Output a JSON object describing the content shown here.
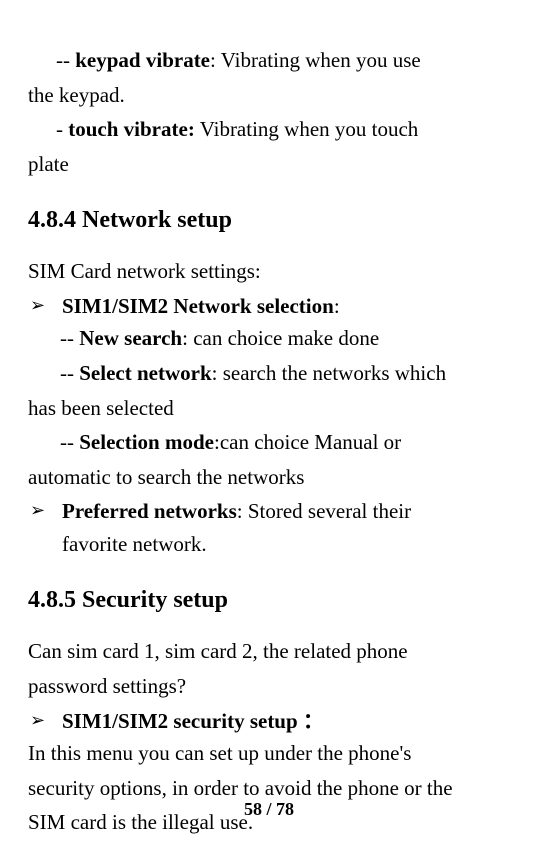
{
  "intro": {
    "line1_prefix": "--  ",
    "line1_bold": "keypad vibrate",
    "line1_colon": ":",
    "line1_rest": "  Vibrating when you use",
    "line2": "the keypad.",
    "line3_prefix": "-  ",
    "line3_bold": "touch vibrate:",
    "line3_rest": " Vibrating when you touch",
    "line4": "plate"
  },
  "section484": {
    "heading": "4.8.4 Network setup",
    "lead": "SIM Card network settings:",
    "bullet1_arrow": "➢",
    "bullet1_bold": "SIM1/SIM2 Network selection",
    "bullet1_colon": ":",
    "sub1_prefix": "-- ",
    "sub1_bold": "New search",
    "sub1_colon": ":",
    "sub1_rest": " can choice make done",
    "sub2_prefix": "-- ",
    "sub2_bold": "Select network",
    "sub2_colon": ":",
    "sub2_rest": " search the networks which",
    "sub2_cont": "has been selected",
    "sub3_prefix": "-- ",
    "sub3_bold": "Selection mode",
    "sub3_colon": ":",
    "sub3_rest": "can choice Manual or",
    "sub3_cont": "automatic to search the networks",
    "bullet2_arrow": "➢",
    "bullet2_bold": "Preferred networks",
    "bullet2_colon": ":",
    "bullet2_rest": " Stored several their",
    "bullet2_cont": "favorite network."
  },
  "section485": {
    "heading": "4.8.5 Security setup",
    "lead1": "Can sim card 1, sim card 2, the related phone",
    "lead2": "password settings?",
    "bullet1_arrow": "➢",
    "bullet1_bold": "SIM1/SIM2 security setup ",
    "bullet1_colon": "：",
    "body1": "In this menu you can set up under the phone's",
    "body2": "security options, in order to avoid the phone or the",
    "body3": "SIM card is the illegal use."
  },
  "footer": {
    "current": "58",
    "sep": " / ",
    "total": "78"
  }
}
